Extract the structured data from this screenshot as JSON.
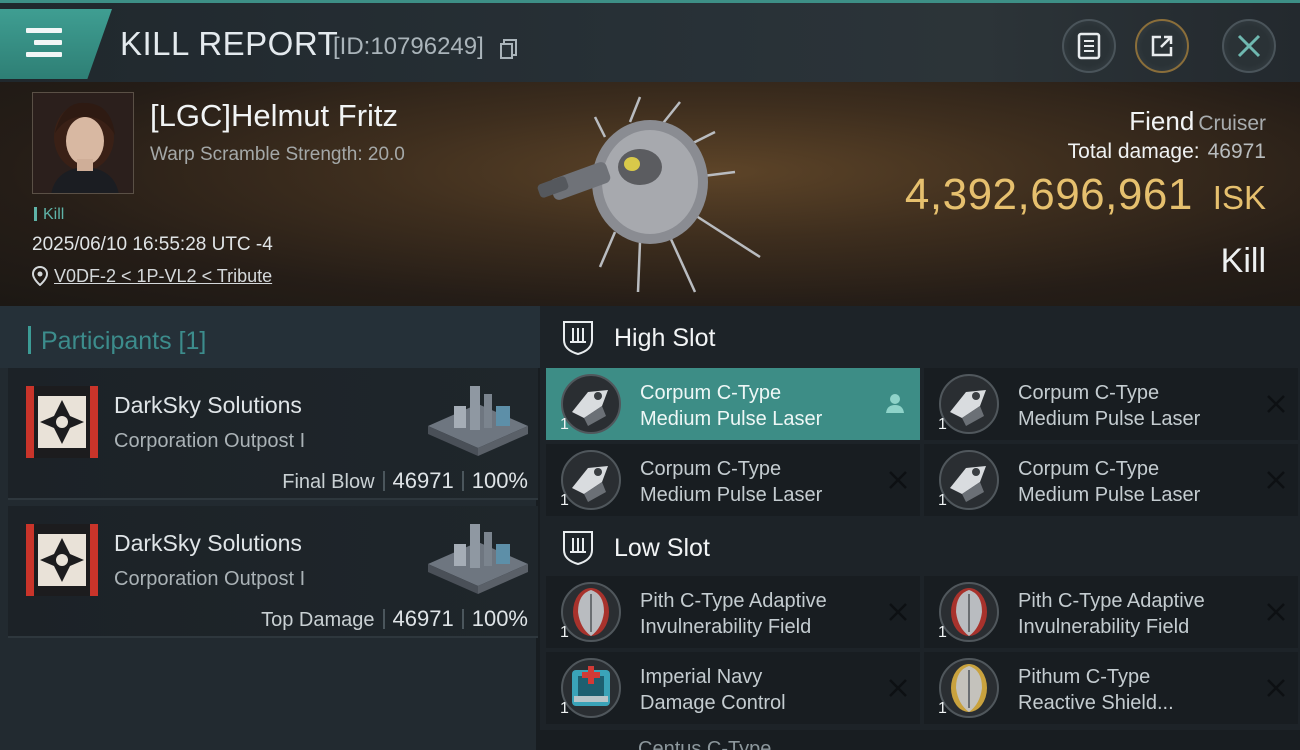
{
  "header": {
    "title": "KILL REPORT",
    "report_id": "[ID:10796249]"
  },
  "victim": {
    "pilot_name": "[LGC]Helmut Fritz",
    "warp_scramble": "Warp Scramble Strength: 20.0",
    "kill_tag": "Kill",
    "datetime": "2025/06/10 16:55:28 UTC -4",
    "location": "V0DF-2 < 1P-VL2 < Tribute"
  },
  "ship": {
    "name": "Fiend",
    "class": "Cruiser",
    "total_damage_label": "Total damage:",
    "total_damage": "46971",
    "isk_value": "4,392,696,961",
    "isk_unit": "ISK",
    "result": "Kill"
  },
  "participants": {
    "title": "Participants [1]",
    "rows": [
      {
        "corp": "DarkSky Solutions",
        "type": "Corporation Outpost I",
        "role": "Final Blow",
        "damage": "46971",
        "percent": "100%"
      },
      {
        "corp": "DarkSky Solutions",
        "type": "Corporation Outpost I",
        "role": "Top Damage",
        "damage": "46971",
        "percent": "100%"
      }
    ]
  },
  "fitting": {
    "high_slot_label": "High Slot",
    "low_slot_label": "Low Slot",
    "high": [
      {
        "line1": "Corpum C-Type",
        "line2": "Medium Pulse Laser",
        "qty": "1"
      },
      {
        "line1": "Corpum C-Type",
        "line2": "Medium Pulse Laser",
        "qty": "1"
      },
      {
        "line1": "Corpum C-Type",
        "line2": "Medium Pulse Laser",
        "qty": "1"
      },
      {
        "line1": "Corpum C-Type",
        "line2": "Medium Pulse Laser",
        "qty": "1"
      }
    ],
    "low": [
      {
        "line1": "Pith C-Type Adaptive",
        "line2": "Invulnerability Field",
        "qty": "1"
      },
      {
        "line1": "Pith C-Type Adaptive",
        "line2": "Invulnerability Field",
        "qty": "1"
      },
      {
        "line1": "Imperial Navy",
        "line2": "Damage Control",
        "qty": "1"
      },
      {
        "line1": "Pithum C-Type",
        "line2": "Reactive Shield...",
        "qty": "1"
      }
    ],
    "partial_next": "Centus C-Type..."
  },
  "colors": {
    "accent_teal": "#3d8d86",
    "isk_gold": "#e6c06e"
  },
  "icons": [
    "menu-icon",
    "copy-icon",
    "report-icon",
    "share-icon",
    "close-icon",
    "location-pin-icon",
    "shield-slot-icon",
    "pilot-icon",
    "x-icon"
  ]
}
